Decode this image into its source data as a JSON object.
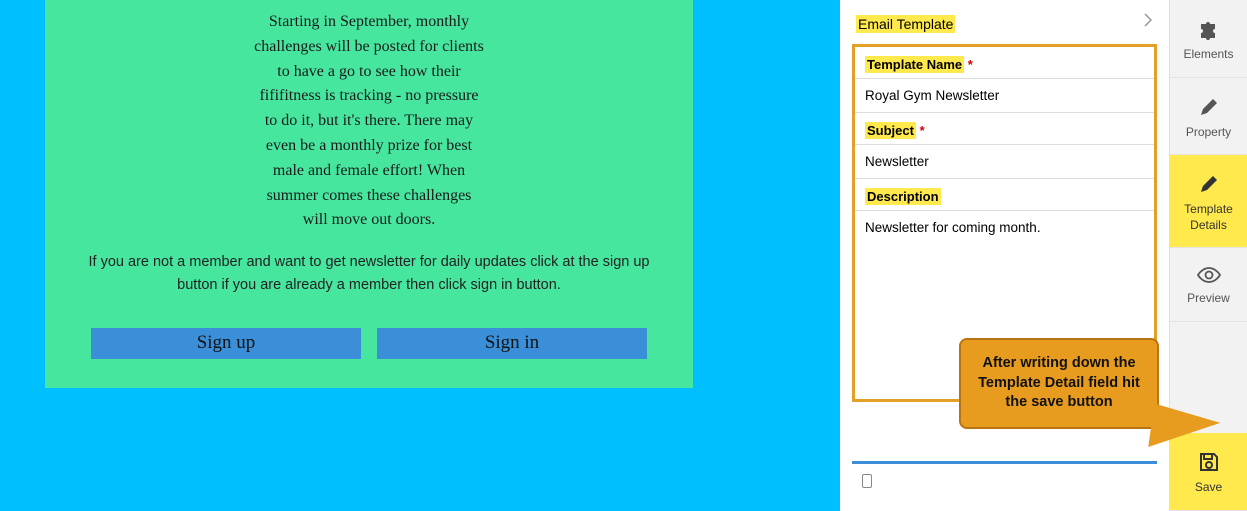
{
  "canvas": {
    "intro_text": "Starting in September, monthly challenges will be posted for clients to have a go to see how their fififitness is tracking - no pressure to do it, but it's there. There may even be a monthly prize for best male and female effort! When summer comes these challenges will move out doors.",
    "cta_text": "If you are not a member and want to get newsletter for daily updates click at the sign up button if you are already a member then click sign in button.",
    "signup_label": "Sign up",
    "signin_label": "Sign in"
  },
  "panel": {
    "header": "Email Template",
    "template_name_label": "Template Name",
    "template_name_value": "Royal Gym Newsletter",
    "subject_label": "Subject",
    "subject_value": "Newsletter",
    "description_label": "Description",
    "description_value": "Newsletter for coming month."
  },
  "callout": {
    "text": "After writing down the Template Detail field hit the save button"
  },
  "toolbar": {
    "elements": "Elements",
    "property": "Property",
    "template_details": "Template Details",
    "preview": "Preview",
    "save": "Save"
  }
}
